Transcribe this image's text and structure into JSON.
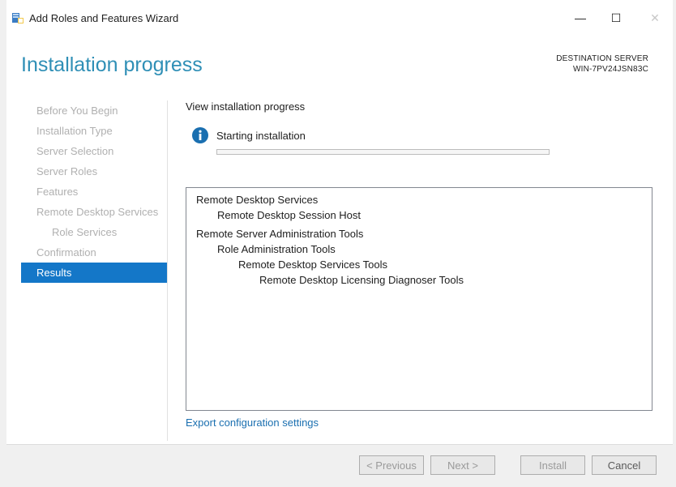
{
  "window": {
    "title": "Add Roles and Features Wizard",
    "controls": {
      "minimize": "—",
      "maximize": "☐",
      "close": "✕"
    }
  },
  "header": {
    "page_title": "Installation progress",
    "destination_label": "DESTINATION SERVER",
    "destination_value": "WIN-7PV24JSN83C"
  },
  "nav": {
    "items": [
      {
        "label": "Before You Begin"
      },
      {
        "label": "Installation Type"
      },
      {
        "label": "Server Selection"
      },
      {
        "label": "Server Roles"
      },
      {
        "label": "Features"
      },
      {
        "label": "Remote Desktop Services"
      },
      {
        "label": "Role Services"
      },
      {
        "label": "Confirmation"
      },
      {
        "label": "Results"
      }
    ]
  },
  "content": {
    "heading": "View installation progress",
    "status": "Starting installation",
    "progress_fraction": 0.0,
    "features": [
      {
        "label": "Remote Desktop Services"
      },
      {
        "label": "Remote Desktop Session Host"
      },
      {
        "label": "Remote Server Administration Tools"
      },
      {
        "label": "Role Administration Tools"
      },
      {
        "label": "Remote Desktop Services Tools"
      },
      {
        "label": "Remote Desktop Licensing Diagnoser Tools"
      }
    ],
    "export_link": "Export configuration settings"
  },
  "footer": {
    "previous": "< Previous",
    "next": "Next >",
    "install": "Install",
    "cancel": "Cancel"
  },
  "colors": {
    "accent": "#2f8fb6",
    "nav_active": "#1477c8",
    "link": "#1a6fb0",
    "info_icon": "#1a6fb0"
  }
}
